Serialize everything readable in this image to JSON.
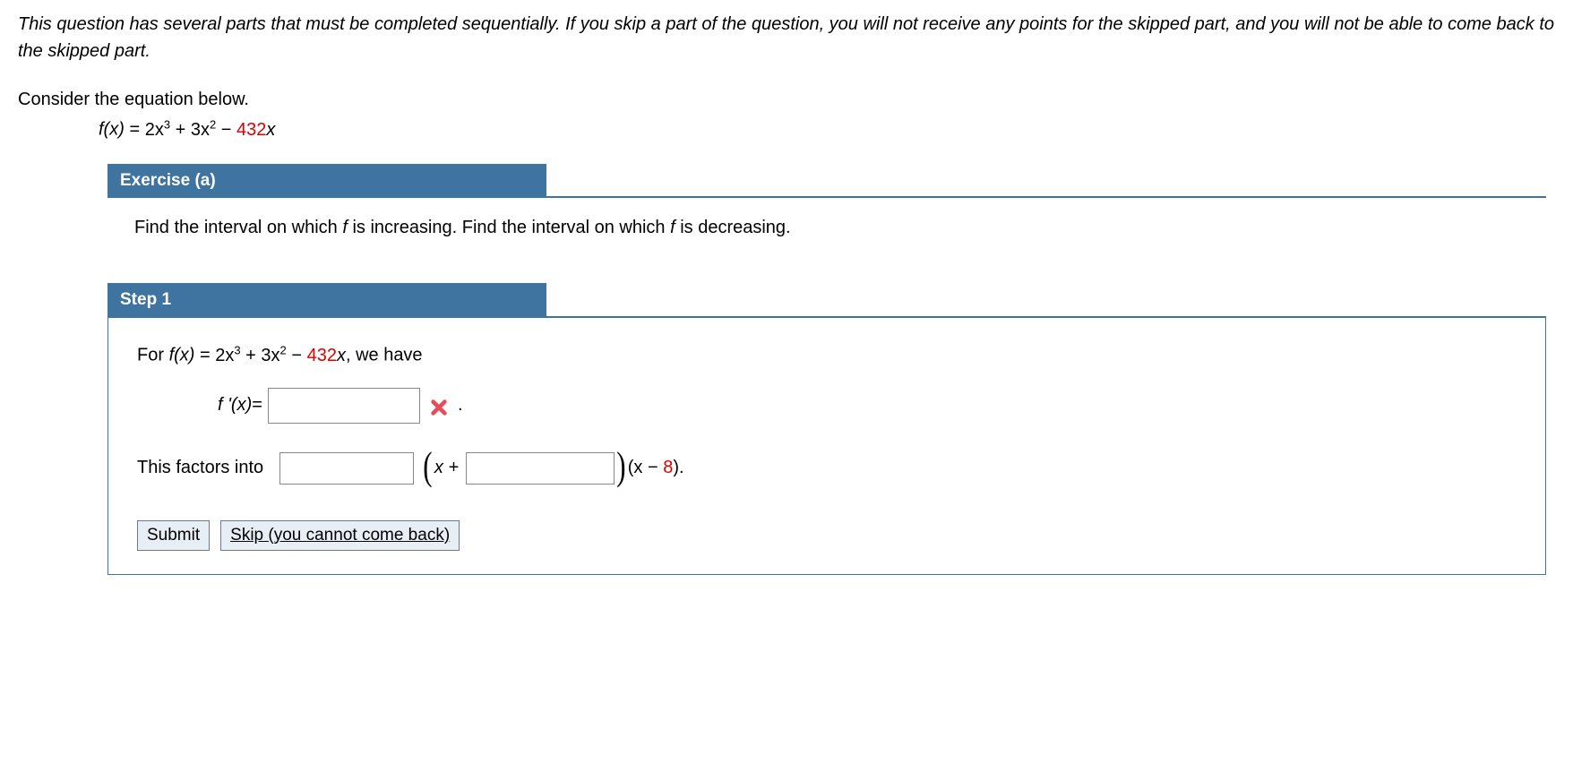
{
  "instructions": "This question has several parts that must be completed sequentially. If you skip a part of the question, you will not receive any points for the skipped part, and you will not be able to come back to the skipped part.",
  "prompt": "Consider the equation below.",
  "equation": {
    "lhs": "f(x)",
    "rhs_part1": "2x",
    "exp1": "3",
    "rhs_part2": " + 3x",
    "exp2": "2",
    "rhs_part3": " − ",
    "coeff_red": "432",
    "rhs_tail": "x"
  },
  "exercise": {
    "label": "Exercise (a)",
    "body_pre": "Find the interval on which ",
    "body_mid1": " is increasing. Find the interval on which ",
    "body_post": " is decreasing.",
    "f_italic": "f"
  },
  "step": {
    "label": "Step 1",
    "line1_pre": "For  ",
    "line1_mid": ",  we have",
    "fprime": "f '(x)",
    "equals": " = ",
    "period": ".",
    "factors_text": "This factors into",
    "paren_x_plus": "x + ",
    "tail_pre": "(x − ",
    "tail_red": "8",
    "tail_post": ")."
  },
  "buttons": {
    "submit": "Submit",
    "skip": "Skip (you cannot come back)"
  }
}
